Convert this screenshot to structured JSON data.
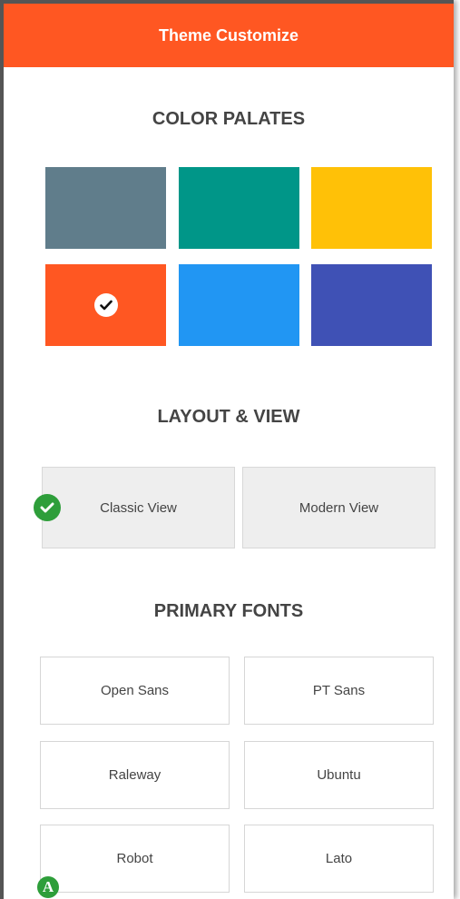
{
  "header": {
    "title": "Theme Customize",
    "color": "#ff5722"
  },
  "sections": {
    "color_palates": "COLOR PALATES",
    "layout_view": "LAYOUT & VIEW",
    "primary_fonts": "PRIMARY FONTS"
  },
  "palette": {
    "swatches": [
      {
        "name": "blue-grey",
        "color": "#607d8b",
        "selected": false
      },
      {
        "name": "teal",
        "color": "#009688",
        "selected": false
      },
      {
        "name": "amber",
        "color": "#ffc107",
        "selected": false
      },
      {
        "name": "deep-orange",
        "color": "#ff5722",
        "selected": true
      },
      {
        "name": "blue",
        "color": "#2196f3",
        "selected": false
      },
      {
        "name": "indigo",
        "color": "#3f51b5",
        "selected": false
      }
    ],
    "selected_icon": "check-icon"
  },
  "layout": {
    "options": [
      {
        "label": "Classic View",
        "selected": true
      },
      {
        "label": "Modern View",
        "selected": false
      }
    ],
    "selected_icon": "check-circle-icon",
    "accent": "#2e9e3a"
  },
  "fonts": {
    "options": [
      {
        "label": "Open Sans",
        "selected": false
      },
      {
        "label": "PT Sans",
        "selected": false
      },
      {
        "label": "Raleway",
        "selected": false
      },
      {
        "label": "Ubuntu",
        "selected": false
      },
      {
        "label": "Robot",
        "selected": true
      },
      {
        "label": "Lato",
        "selected": false
      }
    ],
    "selected_badge": "A"
  }
}
